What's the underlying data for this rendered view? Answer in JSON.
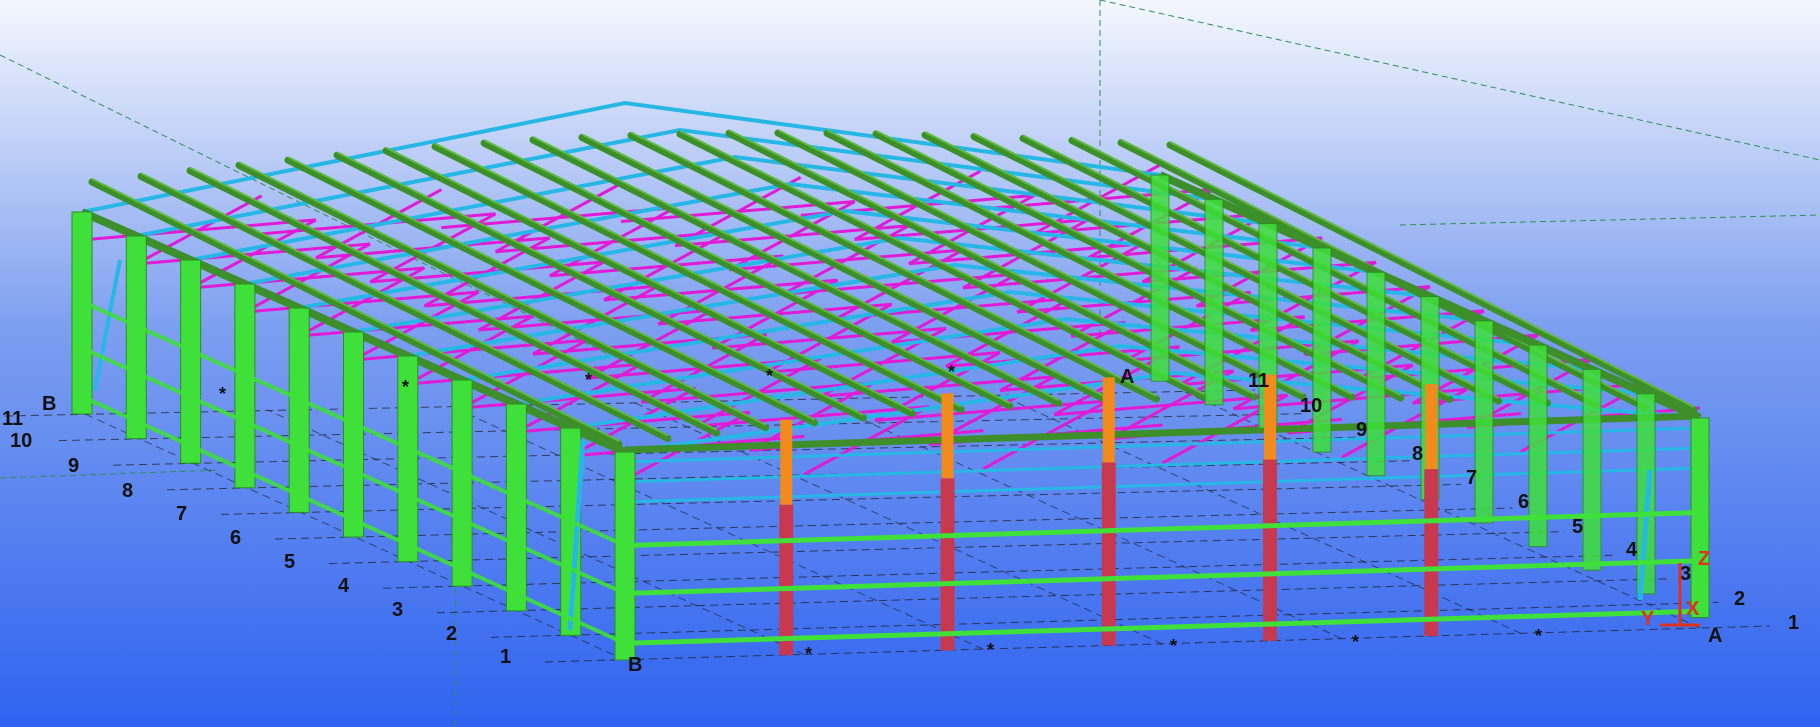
{
  "colors": {
    "background_top": "#f4f7fd",
    "background_mid": "#7d9ff0",
    "background_bottom": "#2f63f0",
    "column_green": "#3fe03a",
    "purlin_green": "#3c8f2a",
    "rafter_cyan": "#27b7e6",
    "bracing_magenta": "#e11ad6",
    "column_red": "#c8394f",
    "gusset_orange": "#f28a1c",
    "grid_line": "#1a1a1a",
    "axis_red": "#e0301e"
  },
  "grid": {
    "left_row_labels": [
      "11",
      "10",
      "9",
      "8",
      "7",
      "6",
      "5",
      "4",
      "3",
      "2",
      "1"
    ],
    "right_row_labels": [
      "11",
      "10",
      "9",
      "8",
      "7",
      "6",
      "5",
      "4",
      "3",
      "2",
      "1"
    ],
    "axis_label_B_top": "B",
    "axis_label_B_bottom": "B",
    "axis_label_A_top": "A",
    "axis_label_A_right": "A",
    "star_marker": "*"
  },
  "axes_gizmo": {
    "z": "Z",
    "x": "X",
    "y": "Y"
  }
}
